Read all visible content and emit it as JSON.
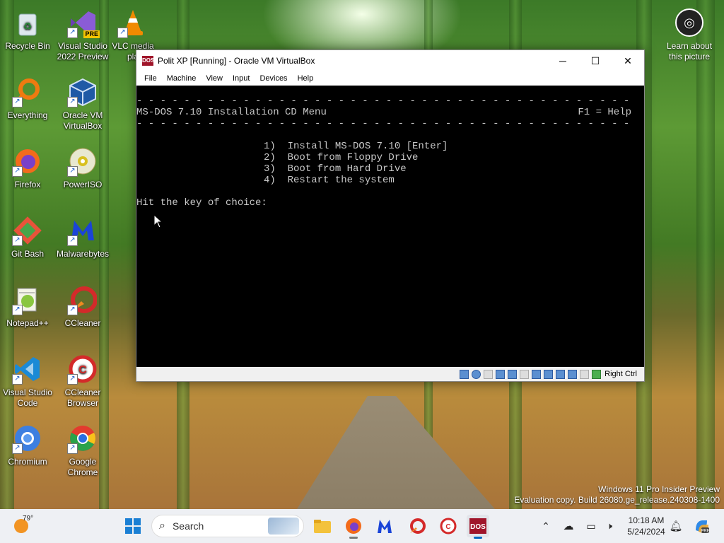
{
  "desktop_icons": [
    {
      "label": "Recycle Bin",
      "icon": "recycle-bin-icon"
    },
    {
      "label": "Visual Studio 2022 Preview",
      "icon": "visual-studio-icon",
      "badge": "PRE"
    },
    {
      "label": "VLC media pla",
      "icon": "vlc-icon"
    },
    {
      "label": "Everything",
      "icon": "everything-search-icon"
    },
    {
      "label": "Oracle VM VirtualBox",
      "icon": "virtualbox-icon"
    },
    {
      "label": "Firefox",
      "icon": "firefox-icon"
    },
    {
      "label": "PowerISO",
      "icon": "poweriso-icon"
    },
    {
      "label": "Git Bash",
      "icon": "git-bash-icon"
    },
    {
      "label": "Malwarebytes",
      "icon": "malwarebytes-icon"
    },
    {
      "label": "Notepad++",
      "icon": "notepadpp-icon"
    },
    {
      "label": "CCleaner",
      "icon": "ccleaner-icon"
    },
    {
      "label": "Visual Studio Code",
      "icon": "vscode-icon"
    },
    {
      "label": "CCleaner Browser",
      "icon": "ccleaner-browser-icon"
    },
    {
      "label": "Chromium",
      "icon": "chromium-icon"
    },
    {
      "label": "Google Chrome",
      "icon": "chrome-icon"
    }
  ],
  "learn_picture": "Learn about this picture",
  "window": {
    "title": "Polit XP [Running] - Oracle VM VirtualBox",
    "menu": [
      "File",
      "Machine",
      "View",
      "Input",
      "Devices",
      "Help"
    ],
    "status_host_key": "Right Ctrl"
  },
  "dos": {
    "header_left": "MS-DOS 7.10 Installation CD Menu",
    "header_right": "F1 = Help",
    "options": [
      "1)  Install MS-DOS 7.10 [Enter]",
      "2)  Boot from Floppy Drive",
      "3)  Boot from Hard Drive",
      "4)  Restart the system"
    ],
    "prompt": "Hit the key of choice:"
  },
  "watermark": {
    "line1": "Windows 11 Pro Insider Preview",
    "line2": "Evaluation copy. Build 26080.ge_release.240308-1400"
  },
  "taskbar": {
    "temperature": "79°",
    "search_placeholder": "Search",
    "time": "10:18 AM",
    "date": "5/24/2024"
  },
  "colors": {
    "dos_text": "#c8c8c8",
    "taskbar_bg": "#eef0f4",
    "accent": "#0067c0"
  }
}
